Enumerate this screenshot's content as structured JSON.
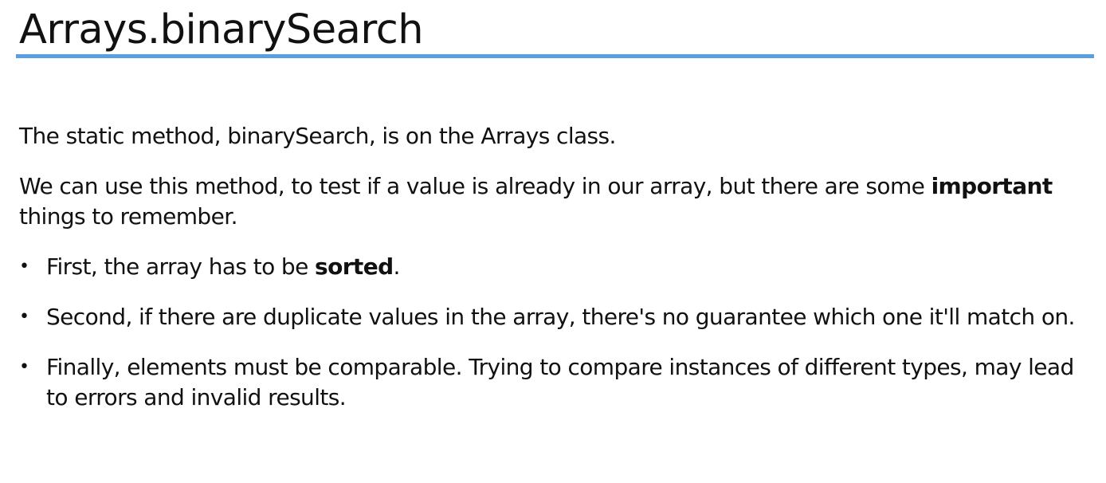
{
  "title": "Arrays.binarySearch",
  "paragraphs": {
    "p1": "The static method, binarySearch, is on the Arrays class.",
    "p2_before": "We can use this method, to test if a value is already in our array, but there are some ",
    "p2_bold": "important",
    "p2_after": " things to remember."
  },
  "bullets": {
    "b1_before": "First, the array has to be ",
    "b1_bold": "sorted",
    "b1_after": ".",
    "b2": "Second, if there are duplicate values in the array, there's no guarantee which one it'll match on.",
    "b3": "Finally, elements must be comparable.  Trying to compare instances of different types, may lead to errors and invalid results."
  },
  "bullet_char": "•",
  "colors": {
    "rule": "#5b9fe3",
    "text": "#111111",
    "background": "#ffffff"
  }
}
